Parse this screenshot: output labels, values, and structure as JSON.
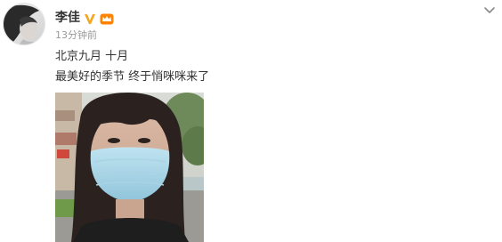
{
  "post": {
    "username": "李佳",
    "timestamp": "13分钟前",
    "content_lines": [
      "北京九月 十月",
      "最美好的季节 终于悄咪咪来了"
    ]
  },
  "icons": {
    "verified": "verified-v-icon",
    "member": "member-crown-icon",
    "menu": "chevron-down-icon"
  },
  "colors": {
    "username": "#333333",
    "text": "#333333",
    "timestamp": "#999999",
    "verified": "#f5a623",
    "member": "#ff8200"
  }
}
